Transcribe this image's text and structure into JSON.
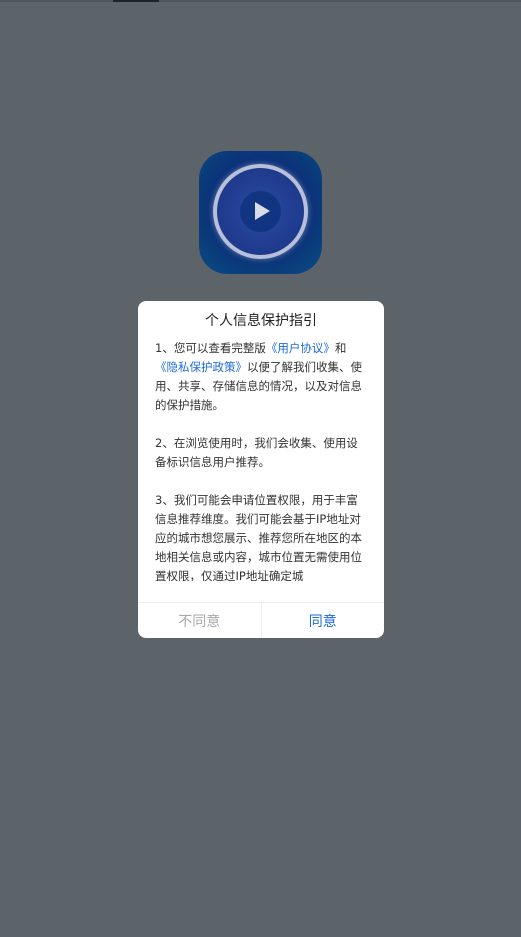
{
  "app": {
    "icon_name": "video-player-icon"
  },
  "dialog": {
    "title": "个人信息保护指引",
    "paragraph1": {
      "prefix": "1、您可以查看完整版",
      "link_user_agreement": "《用户协议》",
      "middle": "和",
      "link_privacy_policy": "《隐私保护政策》",
      "suffix": "以便了解我们收集、使用、共享、存储信息的情况，以及对信息的保护措施。"
    },
    "paragraph2": "2、在浏览使用时，我们会收集、使用设备标识信息用户推荐。",
    "paragraph3": "3、我们可能会申请位置权限，用于丰富信息推荐维度。我们可能会基于IP地址对应的城市想您展示、推荐您所在地区的本地相关信息或内容，城市位置无需使用位置权限，仅通过IP地址确定城",
    "disagree_label": "不同意",
    "agree_label": "同意"
  },
  "colors": {
    "background": "#5c6469",
    "link": "#1e6bd6",
    "disagree": "#a8a8a8"
  }
}
